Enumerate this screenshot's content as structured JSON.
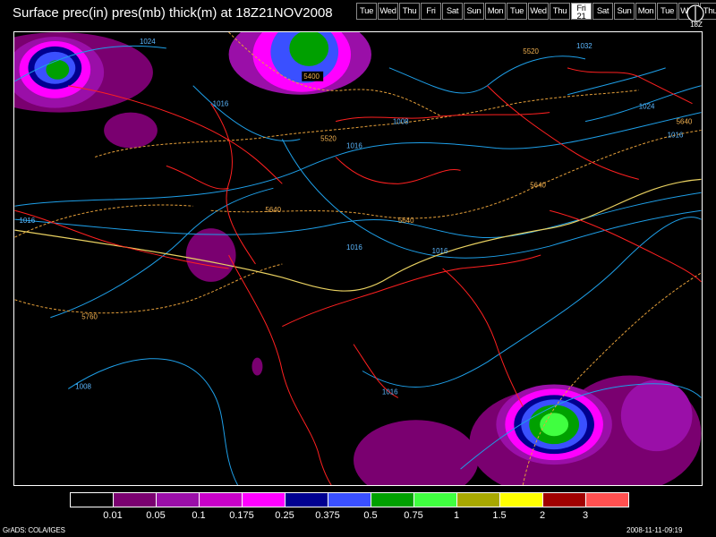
{
  "header": {
    "title": "Surface prec(in) pres(mb) thick(m) at 18Z21NOV2008",
    "days": [
      {
        "label": "Tue"
      },
      {
        "label": "Wed"
      },
      {
        "label": "Thu"
      },
      {
        "label": "Fri"
      },
      {
        "label": "Sat"
      },
      {
        "label": "Sun"
      },
      {
        "label": "Mon"
      },
      {
        "label": "Tue"
      },
      {
        "label": "Wed"
      },
      {
        "label": "Thu"
      },
      {
        "label": "Fri",
        "sub": "21",
        "active": true
      },
      {
        "label": "Sat"
      },
      {
        "label": "Sun"
      },
      {
        "label": "Mon"
      },
      {
        "label": "Tue"
      },
      {
        "label": "Wed"
      },
      {
        "label": "Thu"
      }
    ],
    "clock_label": "18Z"
  },
  "map": {
    "pressure_labels": [
      "1024",
      "1016",
      "1008",
      "1016",
      "1016",
      "1016",
      "1016",
      "1008",
      "1016",
      "1032",
      "1024",
      "1016"
    ],
    "thickness_labels": [
      "5400",
      "5520",
      "5520",
      "5640",
      "5640",
      "5640",
      "5640",
      "5760"
    ],
    "colors": {
      "pressure": "#1e9fe8",
      "thickness": "#e6a03a",
      "coastline": "#ff2020"
    }
  },
  "legend": {
    "colors": [
      "#000000",
      "#7a0070",
      "#9a0fa8",
      "#c800c8",
      "#ff00ff",
      "#000090",
      "#3a50ff",
      "#00a000",
      "#40ff40",
      "#a8a800",
      "#ffff00",
      "#a00000",
      "#ff5050"
    ],
    "labels": [
      "0.01",
      "0.05",
      "0.1",
      "0.175",
      "0.25",
      "0.375",
      "0.5",
      "0.75",
      "1",
      "1.5",
      "2",
      "3"
    ]
  },
  "footer": {
    "left": "GrADS: COLA/IGES",
    "right": "2008-11-11-09:19"
  }
}
